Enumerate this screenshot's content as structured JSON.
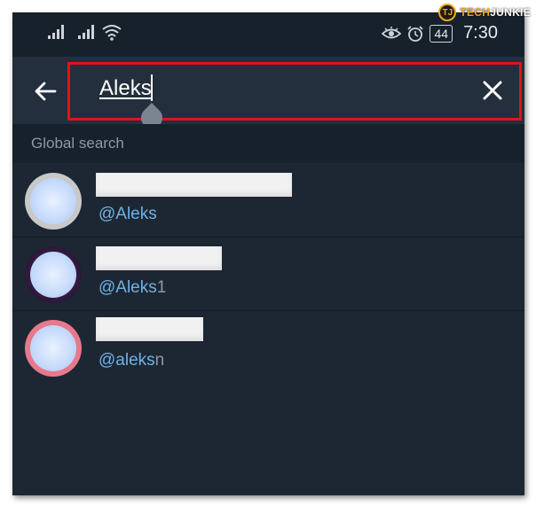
{
  "status_bar": {
    "time": "7:30",
    "battery": "44",
    "icons": [
      "signal-icon",
      "signal-icon",
      "wifi-icon",
      "eye-icon",
      "alarm-icon",
      "battery-icon"
    ]
  },
  "watermark": {
    "badge": "TJ",
    "text_tech": "TECH",
    "text_rest": "JUNKIE"
  },
  "search": {
    "query": "Aleks"
  },
  "section": {
    "title": "Global search"
  },
  "results": [
    {
      "username_match": "@Aleks",
      "username_rest": "",
      "avatar_ring": "#c8c8c8"
    },
    {
      "username_match": "@Aleks",
      "username_rest": "1",
      "avatar_ring": "#3a1f47"
    },
    {
      "username_match": "@aleks",
      "username_rest": "n",
      "avatar_ring": "#e8788c"
    }
  ],
  "colors": {
    "background": "#1d2733",
    "header": "#232f3c",
    "accent_link": "#6fb2e6",
    "highlight_frame": "#e1121b"
  }
}
